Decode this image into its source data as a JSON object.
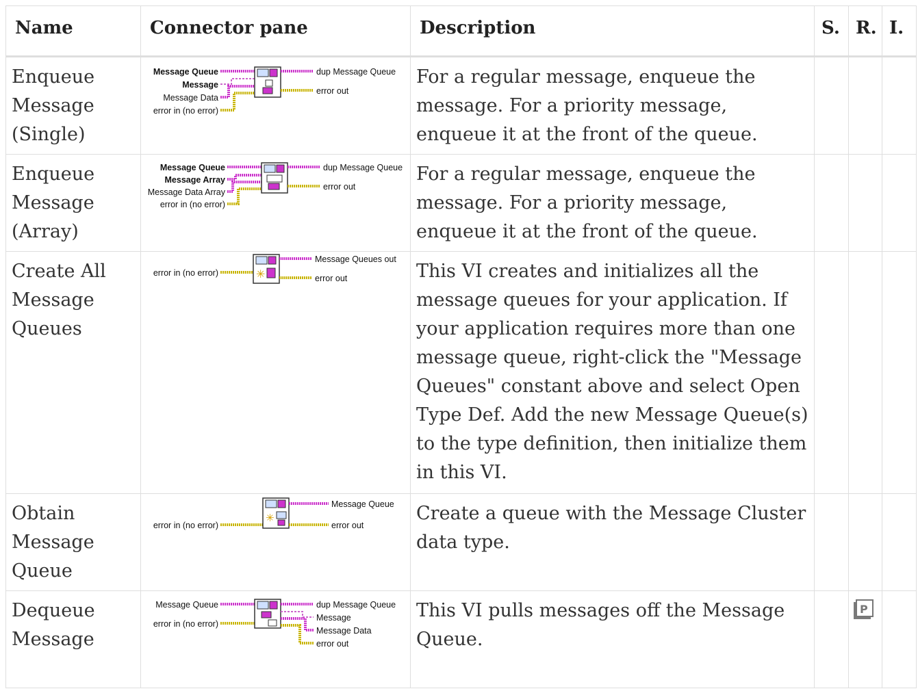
{
  "headers": {
    "name": "Name",
    "connector": "Connector pane",
    "description": "Description",
    "s": "S.",
    "r": "R.",
    "i": "I."
  },
  "rows": [
    {
      "name": "Enqueue Message (Single)",
      "description": "For a regular message, enqueue the message. For a priority message, enqueue it at the front of the queue.",
      "connector": {
        "inputs": [
          "Message Queue",
          "Message",
          "Message Data",
          "error in (no error)"
        ],
        "outputs": [
          "dup Message Queue",
          "error out"
        ]
      }
    },
    {
      "name": "Enqueue Message (Array)",
      "description": "For a regular message, enqueue the message. For a priority message, enqueue it at the front of the queue.",
      "connector": {
        "inputs": [
          "Message Queue",
          "Message Array",
          "Message Data Array",
          "error in (no error)"
        ],
        "outputs": [
          "dup Message Queue",
          "error out"
        ]
      }
    },
    {
      "name": "Create All Message Queues",
      "description": "This VI creates and initializes all the message queues for your application. If your application requires more than one message queue, right-click the \"Message Queues\" constant above and select Open Type Def. Add the new Message Queue(s) to the type definition, then initialize them in this VI.",
      "connector": {
        "inputs": [
          "error in (no error)"
        ],
        "outputs": [
          "Message Queues out",
          "error out"
        ]
      }
    },
    {
      "name": "Obtain Message Queue",
      "description": "Create a queue with the Message Cluster data type.",
      "connector": {
        "inputs": [
          "error in (no error)"
        ],
        "outputs": [
          "Message Queue",
          "error out"
        ]
      }
    },
    {
      "name": "Dequeue Message",
      "description": "This VI pulls messages off the Message Queue.",
      "connector": {
        "inputs": [
          "Message Queue",
          "error in (no error)"
        ],
        "outputs": [
          "dup Message Queue",
          "Message",
          "Message Data",
          "error out"
        ]
      }
    }
  ],
  "colors": {
    "queue_wire": "#cc33cc",
    "error_wire": "#c8b400",
    "border": "#dedede"
  }
}
